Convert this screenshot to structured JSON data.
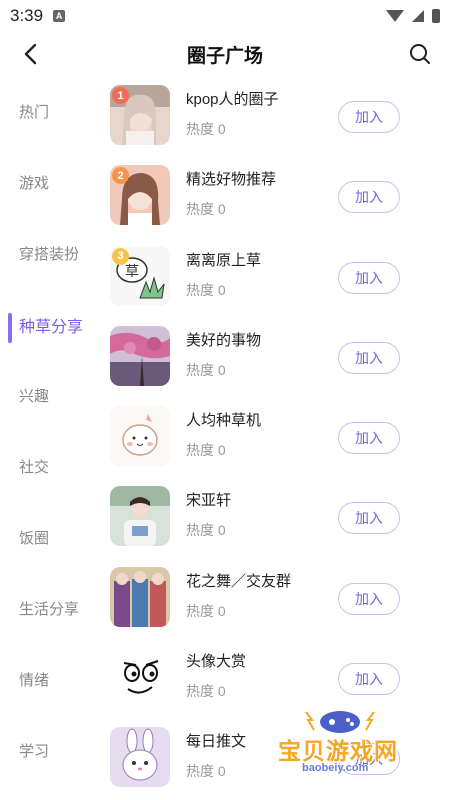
{
  "status": {
    "time": "3:39",
    "a_icon": "A"
  },
  "header": {
    "title": "圈子广场"
  },
  "sidebar": {
    "items": [
      {
        "label": "热门"
      },
      {
        "label": "游戏"
      },
      {
        "label": "穿搭装扮"
      },
      {
        "label": "种草分享",
        "active": true
      },
      {
        "label": "兴趣"
      },
      {
        "label": "社交"
      },
      {
        "label": "饭圈"
      },
      {
        "label": "生活分享"
      },
      {
        "label": "情绪"
      },
      {
        "label": "学习"
      }
    ]
  },
  "groups": [
    {
      "rank": "1",
      "rank_color": "#f46a5a",
      "name": "kpop人的圈子",
      "heat": "热度 0",
      "join": "加入",
      "avatar": "selfie-photo"
    },
    {
      "rank": "2",
      "rank_color": "#f5954a",
      "name": "精选好物推荐",
      "heat": "热度 0",
      "join": "加入",
      "avatar": "selfie-photo"
    },
    {
      "rank": "3",
      "rank_color": "#f7c34c",
      "name": "离离原上草",
      "heat": "热度 0",
      "join": "加入",
      "avatar": "grass-drawing",
      "avatar_text": "草"
    },
    {
      "rank": "",
      "name": "美好的事物",
      "heat": "热度 0",
      "join": "加入",
      "avatar": "blossom-landscape"
    },
    {
      "rank": "",
      "name": "人均种草机",
      "heat": "热度 0",
      "join": "加入",
      "avatar": "cartoon-character"
    },
    {
      "rank": "",
      "name": "宋亚轩",
      "heat": "热度 0",
      "join": "加入",
      "avatar": "person-photo"
    },
    {
      "rank": "",
      "name": "花之舞／交友群",
      "heat": "热度 0",
      "join": "加入",
      "avatar": "costume-group"
    },
    {
      "rank": "",
      "name": "头像大赏",
      "heat": "热度 0",
      "join": "加入",
      "avatar": "doodle-face"
    },
    {
      "rank": "",
      "name": "每日推文",
      "heat": "热度 0",
      "join": "加入",
      "avatar": "bunny-drawing"
    }
  ],
  "watermark": {
    "text": "宝贝游戏网",
    "url": "baobeiy.com"
  },
  "colors": {
    "accent": "#7a5ee6",
    "button_border": "#c9c0f2"
  }
}
